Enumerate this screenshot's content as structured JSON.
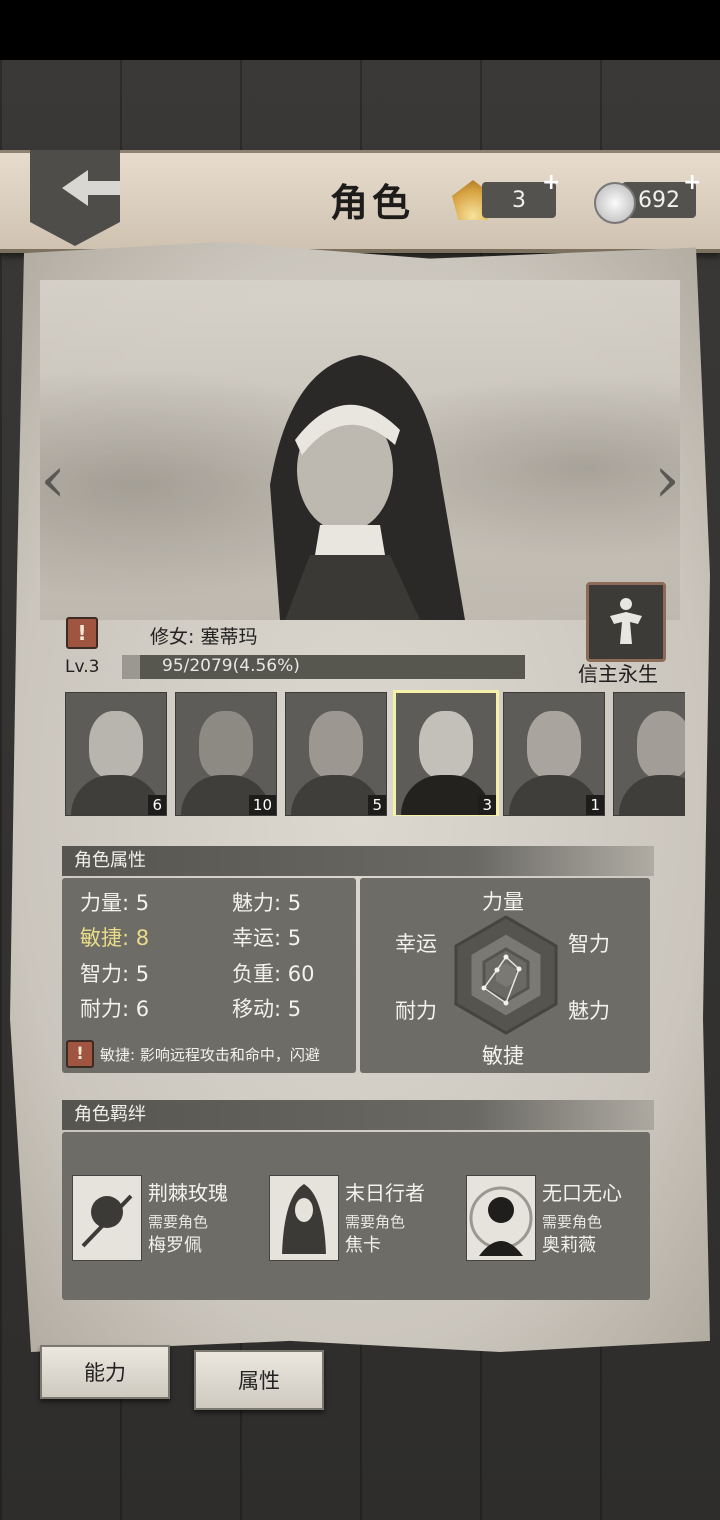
{
  "header": {
    "title": "角色",
    "shells": "3",
    "coins": "692",
    "plus": "+"
  },
  "character": {
    "name": "修女: 塞蒂玛",
    "level": "Lv.3",
    "xp_text": "95/2079(4.56%)",
    "xp_fraction": 0.0456,
    "trait_label": "信主永生",
    "warn_glyph": "!"
  },
  "roster": [
    {
      "level": "6"
    },
    {
      "level": "10"
    },
    {
      "level": "5"
    },
    {
      "level": "3",
      "selected": true
    },
    {
      "level": "1"
    },
    {
      "level": ""
    }
  ],
  "attributes": {
    "section_title": "角色属性",
    "stats": {
      "strength": "力量: 5",
      "charm": "魅力: 5",
      "agility": "敏捷: 8",
      "luck": "幸运: 5",
      "intelligence": "智力: 5",
      "weight": "负重: 60",
      "endurance": "耐力: 6",
      "move": "移动: 5"
    },
    "description": "敏捷: 影响远程攻击和命中，闪避",
    "radar": {
      "labels": {
        "top": "力量",
        "top_left": "幸运",
        "top_right": "智力",
        "bottom_left": "耐力",
        "bottom_right": "魅力",
        "bottom": "敏捷"
      }
    }
  },
  "bonds": {
    "section_title": "角色羁绊",
    "items": [
      {
        "title": "荆棘玫瑰",
        "need": "需要角色",
        "who": "梅罗佩"
      },
      {
        "title": "末日行者",
        "need": "需要角色",
        "who": "焦卡"
      },
      {
        "title": "无口无心",
        "need": "需要角色",
        "who": "奥莉薇"
      }
    ]
  },
  "tabs": {
    "ability": "能力",
    "attribute": "属性"
  }
}
